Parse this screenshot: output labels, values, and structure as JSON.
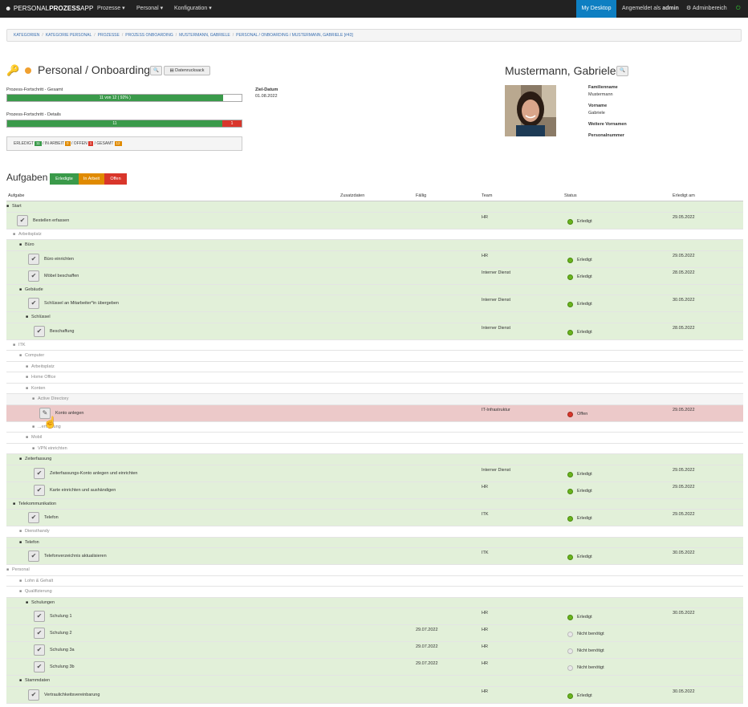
{
  "navbar": {
    "brand_pre": "PERSONAL",
    "brand_bold": "PROZESS",
    "brand_post": "APP",
    "menu": [
      "Prozesse ▾",
      "Personal ▾",
      "Konfiguration ▾"
    ],
    "my_desktop": "My Desktop",
    "logged_in_prefix": "Angemeldet als",
    "logged_in_user": "admin",
    "admin_area": "Adminbereich"
  },
  "breadcrumb": [
    "KATEGORIEN",
    "KATEGORIE PERSONAL",
    "PROZESSE",
    "PROZESS ONBOARDING",
    "MUSTERMANN, GABRIELE",
    "PERSONAL / ONBOARDING / MUSTERMANN, GABRIELE [#43]"
  ],
  "process": {
    "title": "Personal / Onboarding",
    "print_button": "Datenrucksack",
    "progress_total_label": "Prozess-Fortschritt - Gesamt",
    "progress_total_text": "11 von 12 ( 92% )",
    "progress_total_fraction": 0.92,
    "progress_detail_label": "Prozess-Fortschritt - Details",
    "progress_detail_done": "11",
    "progress_detail_open": "1",
    "target_date_label": "Ziel-Datum",
    "target_date": "01.08.2022",
    "counts": {
      "done_label": "ERLEDIGT",
      "done": "11",
      "inwork_label": "IN ARBEIT",
      "inwork": "0",
      "open_label": "OFFEN",
      "open": "1",
      "total_label": "GESAMT",
      "total": "12"
    }
  },
  "person": {
    "name": "Mustermann, Gabriele",
    "fields": [
      {
        "label": "Familienname",
        "value": "Mustermann"
      },
      {
        "label": "Vorname",
        "value": "Gabriele"
      },
      {
        "label": "Weitere Vornamen",
        "value": ""
      },
      {
        "label": "Personalnummer",
        "value": ""
      }
    ]
  },
  "tasks": {
    "title": "Aufgaben",
    "filters": [
      "Erledigte",
      "In Arbeit",
      "Offen"
    ],
    "headers": [
      "Aufgabe",
      "Zusatzdaten",
      "Fällig",
      "Team",
      "Status",
      "Erledigt am"
    ],
    "status_done": "Erledigt",
    "status_open": "Offen",
    "status_na": "Nicht benötigt",
    "rows": [
      {
        "kind": "folder",
        "level": 0,
        "label": "Start",
        "style": "ok"
      },
      {
        "kind": "task",
        "level": 1,
        "label": "Bestellen erfassen",
        "team": "HR",
        "status": "done",
        "date": "29.05.2022"
      },
      {
        "kind": "folder",
        "level": 1,
        "label": "Arbeitsplatz",
        "style": "white"
      },
      {
        "kind": "folder",
        "level": 2,
        "label": "Büro",
        "style": "ok"
      },
      {
        "kind": "task",
        "level": 3,
        "label": "Büro einrichten",
        "team": "HR",
        "status": "done",
        "date": "29.05.2022"
      },
      {
        "kind": "task",
        "level": 3,
        "label": "Möbel beschaffen",
        "team": "Interner Dienst",
        "status": "done",
        "date": "28.05.2022"
      },
      {
        "kind": "folder",
        "level": 2,
        "label": "Gebäude",
        "style": "ok"
      },
      {
        "kind": "task",
        "level": 3,
        "label": "Schlüssel an Mitarbeiter*in übergeben",
        "team": "Interner Dienst",
        "status": "done",
        "date": "30.05.2022"
      },
      {
        "kind": "folder",
        "level": 3,
        "label": "Schlüssel",
        "style": "ok"
      },
      {
        "kind": "task",
        "level": 4,
        "label": "Beschaffung",
        "team": "Interner Dienst",
        "status": "done",
        "date": "28.05.2022"
      },
      {
        "kind": "folder",
        "level": 1,
        "label": "ITK",
        "style": "white"
      },
      {
        "kind": "folder",
        "level": 2,
        "label": "Computer",
        "style": "white"
      },
      {
        "kind": "folder",
        "level": 3,
        "label": "Arbeitsplatz",
        "style": "white"
      },
      {
        "kind": "folder",
        "level": 3,
        "label": "Home Office",
        "style": "white"
      },
      {
        "kind": "folder",
        "level": 3,
        "label": "Konten",
        "style": "white"
      },
      {
        "kind": "folder",
        "level": 4,
        "label": "Active Directory",
        "style": "light"
      },
      {
        "kind": "task",
        "level": 5,
        "label": "Konto anlegen",
        "team": "IT-Infrastruktur",
        "status": "open",
        "date": "29.05.2022"
      },
      {
        "kind": "folder",
        "level": 4,
        "label": "...erfassung",
        "style": "white"
      },
      {
        "kind": "folder",
        "level": 3,
        "label": "Mobil",
        "style": "white"
      },
      {
        "kind": "folder",
        "level": 4,
        "label": "VPN einrichten",
        "style": "white"
      },
      {
        "kind": "folder",
        "level": 2,
        "label": "Zeiterfassung",
        "style": "ok"
      },
      {
        "kind": "task",
        "level": 4,
        "label": "Zeiterfassungs-Konto anlegen und einrichten",
        "team": "Interner Dienst",
        "status": "done",
        "date": "29.05.2022"
      },
      {
        "kind": "task",
        "level": 4,
        "label": "Karte einrichten und aushändigen",
        "team": "HR",
        "status": "done",
        "date": "29.05.2022"
      },
      {
        "kind": "folder",
        "level": 1,
        "label": "Telekommunikation",
        "style": "ok"
      },
      {
        "kind": "task",
        "level": 3,
        "label": "Telefon",
        "team": "ITK",
        "status": "done",
        "date": "29.05.2022"
      },
      {
        "kind": "folder",
        "level": 2,
        "label": "Diensthandy",
        "style": "white"
      },
      {
        "kind": "folder",
        "level": 2,
        "label": "Telefon",
        "style": "ok"
      },
      {
        "kind": "task",
        "level": 3,
        "label": "Telefonverzeichnis aktualisieren",
        "team": "ITK",
        "status": "done",
        "date": "30.05.2022"
      },
      {
        "kind": "folder",
        "level": 0,
        "label": "Personal",
        "style": "white"
      },
      {
        "kind": "folder",
        "level": 2,
        "label": "Lohn & Gehalt",
        "style": "white"
      },
      {
        "kind": "folder",
        "level": 2,
        "label": "Qualifizierung",
        "style": "white"
      },
      {
        "kind": "folder",
        "level": 3,
        "label": "Schulungen",
        "style": "ok"
      },
      {
        "kind": "task",
        "level": 4,
        "label": "Schulung 1",
        "team": "HR",
        "status": "done",
        "date": "30.05.2022",
        "due": ""
      },
      {
        "kind": "task",
        "level": 4,
        "label": "Schulung 2",
        "team": "HR",
        "status": "na",
        "date": "",
        "due": "29.07.2022"
      },
      {
        "kind": "task",
        "level": 4,
        "label": "Schulung 3a",
        "team": "HR",
        "status": "na",
        "date": "",
        "due": "29.07.2022"
      },
      {
        "kind": "task",
        "level": 4,
        "label": "Schulung 3b",
        "team": "HR",
        "status": "na",
        "date": "",
        "due": "29.07.2022"
      },
      {
        "kind": "folder",
        "level": 2,
        "label": "Stammdaten",
        "style": "ok"
      },
      {
        "kind": "task",
        "level": 3,
        "label": "Vertraulichkeitsvereinbarung",
        "team": "HR",
        "status": "done",
        "date": "30.05.2022"
      }
    ]
  },
  "colors": {
    "done": "#3a9a4a",
    "inwork": "#e08a00",
    "open": "#d9362b",
    "accent": "#0e7fc2"
  }
}
